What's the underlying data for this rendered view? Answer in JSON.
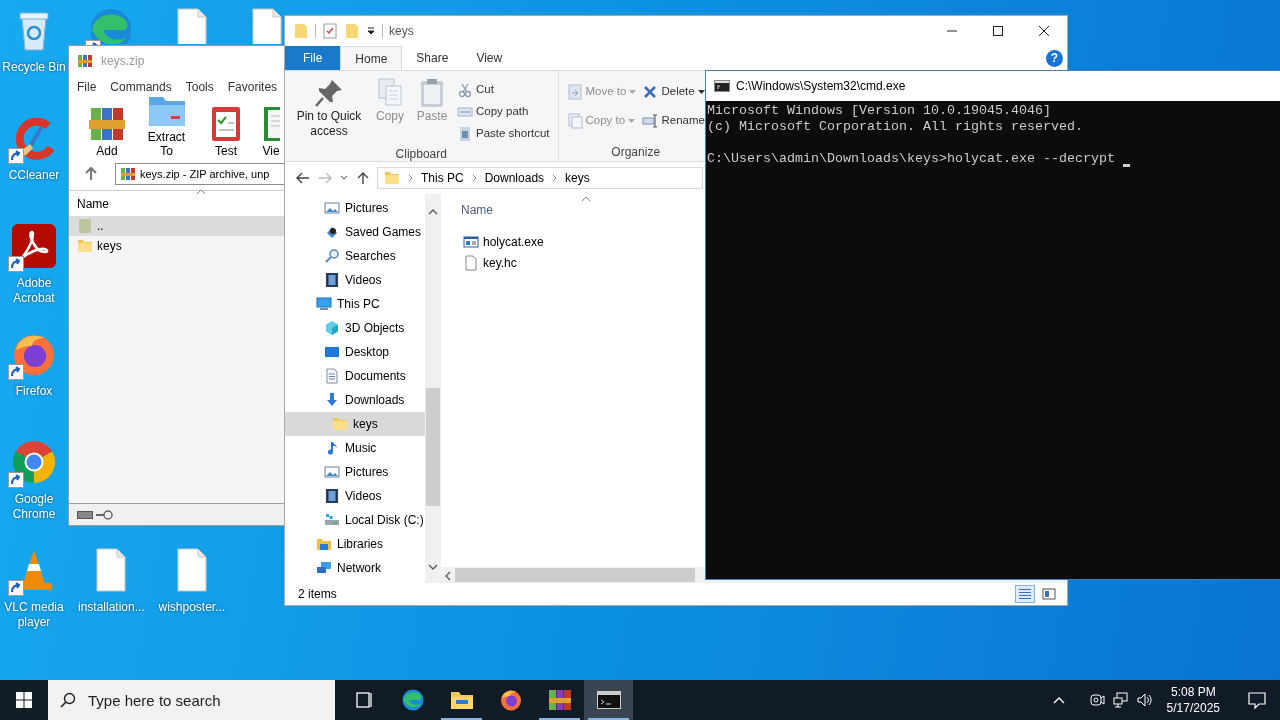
{
  "desktop": {
    "icons": [
      {
        "label": "Recycle Bin",
        "kind": "recycle",
        "shortcut": false
      },
      {
        "label": "CCleaner",
        "kind": "ccleaner",
        "shortcut": true
      },
      {
        "label": "Adobe Acrobat",
        "kind": "acrobat",
        "shortcut": true
      },
      {
        "label": "Firefox",
        "kind": "firefox",
        "shortcut": true
      },
      {
        "label": "Google Chrome",
        "kind": "chrome",
        "shortcut": true
      },
      {
        "label": "VLC media player",
        "kind": "vlc",
        "shortcut": true
      },
      {
        "kind": "edge",
        "shortcut": true
      },
      {
        "label": "installation...",
        "kind": "file",
        "shortcut": false
      },
      {
        "kind": "file",
        "shortcut": false
      },
      {
        "label": "wishposter...",
        "kind": "file",
        "shortcut": false
      },
      {
        "kind": "file",
        "shortcut": false
      }
    ]
  },
  "winrar": {
    "title": "keys.zip",
    "menu": [
      "File",
      "Commands",
      "Tools",
      "Favorites"
    ],
    "toolbar": [
      {
        "label": "Add",
        "kind": "add"
      },
      {
        "label": "Extract To",
        "kind": "extract"
      },
      {
        "label": "Test",
        "kind": "test"
      },
      {
        "label": "Vie",
        "kind": "view"
      }
    ],
    "address": "keys.zip - ZIP archive, unp",
    "column": "Name",
    "rows": [
      {
        "name": "..",
        "kind": "up",
        "selected": true
      },
      {
        "name": "keys",
        "kind": "folder",
        "selected": false
      }
    ]
  },
  "explorer": {
    "title": "keys",
    "tabs": [
      {
        "label": "File",
        "kind": "file",
        "selected": false
      },
      {
        "label": "Home",
        "kind": "tab",
        "selected": true
      },
      {
        "label": "Share",
        "kind": "tab",
        "selected": false
      },
      {
        "label": "View",
        "kind": "tab",
        "selected": false
      }
    ],
    "help": "?",
    "ribbon": {
      "groups": [
        {
          "label": "Clipboard",
          "large": [
            {
              "label": "Pin to Quick access",
              "kind": "pin",
              "disabled": false
            },
            {
              "label": "Copy",
              "kind": "copy",
              "disabled": true
            },
            {
              "label": "Paste",
              "kind": "paste",
              "disabled": true
            }
          ],
          "small": [
            {
              "label": "Cut",
              "kind": "cut",
              "disabled": false,
              "dropdown": false
            },
            {
              "label": "Copy path",
              "kind": "copypath",
              "disabled": false,
              "dropdown": false
            },
            {
              "label": "Paste shortcut",
              "kind": "pasteshortcut",
              "disabled": false,
              "dropdown": false
            }
          ]
        },
        {
          "label": "Organize",
          "small": [
            {
              "label": "Move to",
              "kind": "moveto",
              "disabled": true,
              "dropdown": true
            },
            {
              "label": "Copy to",
              "kind": "copyto",
              "disabled": true,
              "dropdown": true
            },
            {
              "label": "Delete",
              "kind": "delete",
              "disabled": false,
              "dropdown": true
            },
            {
              "label": "Rename",
              "kind": "rename",
              "disabled": false,
              "dropdown": false
            }
          ]
        }
      ]
    },
    "crumbs": [
      "This PC",
      "Downloads",
      "keys"
    ],
    "nav": [
      {
        "children": [
          {
            "label": "Pictures",
            "kind": "pictures",
            "selected": false
          },
          {
            "label": "Saved Games",
            "kind": "games",
            "selected": false
          },
          {
            "label": "Searches",
            "kind": "search",
            "selected": false
          },
          {
            "label": "Videos",
            "kind": "videos",
            "selected": false
          }
        ]
      },
      {
        "label": "This PC",
        "kind": "pc",
        "selected": false,
        "children": [
          {
            "label": "3D Objects",
            "kind": "cube",
            "selected": false
          },
          {
            "label": "Desktop",
            "kind": "desktop",
            "selected": false
          },
          {
            "label": "Documents",
            "kind": "docs",
            "selected": false
          },
          {
            "label": "Downloads",
            "kind": "download",
            "selected": false,
            "children": [
              {
                "label": "keys",
                "kind": "folder",
                "selected": true
              }
            ]
          },
          {
            "label": "Music",
            "kind": "music",
            "selected": false
          },
          {
            "label": "Pictures",
            "kind": "pictures",
            "selected": false
          },
          {
            "label": "Videos",
            "kind": "videos",
            "selected": false
          },
          {
            "label": "Local Disk (C:)",
            "kind": "disk",
            "selected": false
          }
        ]
      },
      {
        "label": "Libraries",
        "kind": "libraries",
        "selected": false
      },
      {
        "label": "Network",
        "kind": "network",
        "selected": false
      }
    ],
    "column": "Name",
    "files": [
      {
        "name": "holycat.exe",
        "kind": "exe"
      },
      {
        "name": "key.hc",
        "kind": "file16"
      }
    ],
    "status": "2 items"
  },
  "cmd": {
    "title": "C:\\Windows\\System32\\cmd.exe",
    "blocks": [
      [
        "Microsoft Windows [Version 10.0.19045.4046]",
        "(c) Microsoft Corporation. All rights reserved."
      ],
      [
        "C:\\Users\\admin\\Downloads\\keys>holycat.exe --decrypt"
      ]
    ],
    "cursor": true
  },
  "taskbar": {
    "search_placeholder": "Type here to search",
    "apps": [
      {
        "kind": "taskview",
        "running": false,
        "active": false
      },
      {
        "kind": "edge",
        "running": false,
        "active": false
      },
      {
        "kind": "explorer",
        "running": true,
        "active": false
      },
      {
        "kind": "firefox",
        "running": false,
        "active": false
      },
      {
        "kind": "winrar",
        "running": true,
        "active": false
      },
      {
        "kind": "cmd",
        "running": true,
        "active": true
      }
    ],
    "time": "5:08 PM",
    "date": "5/17/2025"
  }
}
